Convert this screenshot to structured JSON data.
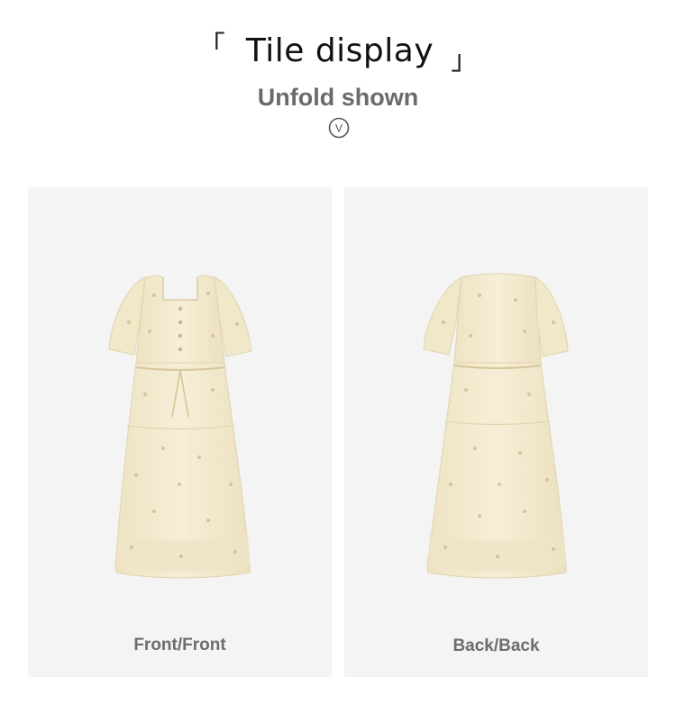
{
  "header": {
    "bracket_left": "「",
    "title": "Tile display",
    "bracket_right": "」",
    "subtitle": "Unfold shown",
    "unfold_glyph": "V"
  },
  "panels": [
    {
      "caption": "Front/Front",
      "view": "front"
    },
    {
      "caption": "Back/Back",
      "view": "back"
    }
  ],
  "colors": {
    "panel_background": "#f4f4f4",
    "dress_fabric": "#f3ead0",
    "floral_print": "#c9b88c",
    "caption_text": "#6d6d6d",
    "subtitle_text": "#6a6a6a"
  }
}
